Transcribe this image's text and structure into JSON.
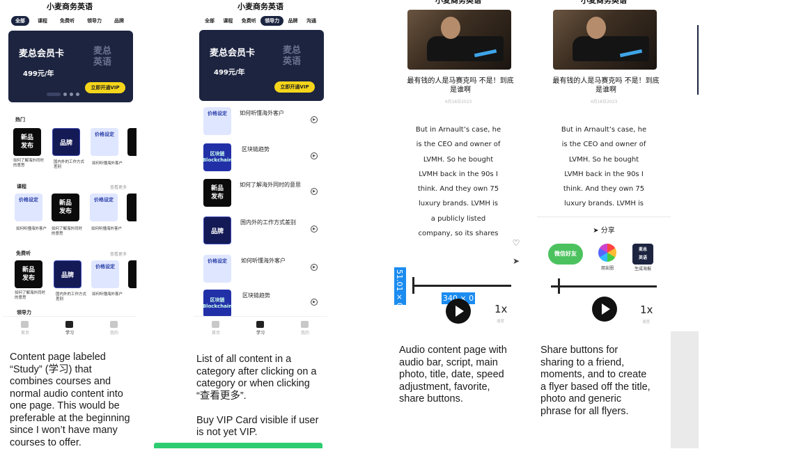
{
  "app": {
    "title": "小麦商务英语"
  },
  "screen1": {
    "tabs": [
      "全部",
      "课程",
      "免费听",
      "领导力",
      "品牌"
    ],
    "vip": {
      "title": "麦总会员卡",
      "price": "499元/年",
      "logo_line1": "麦总",
      "logo_line2": "英语",
      "button": "立即开通VIP"
    },
    "sections": {
      "hot": {
        "title": "热门"
      },
      "course": {
        "title": "课程",
        "more": "查看更多"
      },
      "free": {
        "title": "免费听",
        "more": "查看更多"
      },
      "lead": {
        "title": "领导力"
      }
    },
    "tiles": {
      "new": "新品\n发布",
      "brand": "品牌",
      "price": "价格设定",
      "chain": "区块链\nBlockchain"
    },
    "captions": {
      "c1": "如何了解海外同时的意思",
      "c2": "国内外的工作方式差别",
      "c3": "如何听懂海外客户",
      "c4": "如何了解海外同时的意思"
    },
    "nav": {
      "home": "首页",
      "study": "学习",
      "mine": "我的"
    }
  },
  "screen2": {
    "tabs": [
      "全部",
      "课程",
      "免费听",
      "领导力",
      "品牌",
      "沟通"
    ],
    "vip": {
      "title": "麦总会员卡",
      "price": "499元/年",
      "logo_line1": "麦总",
      "logo_line2": "英语",
      "button": "立即开通VIP"
    },
    "items": [
      {
        "title": "如何听懂海外客户",
        "tile": "价格设定"
      },
      {
        "title": "区块链趋势",
        "tile": "区块链\nBlockchain"
      },
      {
        "title": "如何了解海外同时的意思",
        "tile": "新品\n发布"
      },
      {
        "title": "国内外的工作方式差别",
        "tile": "品牌"
      },
      {
        "title": "如何听懂海外客户",
        "tile": "价格设定"
      },
      {
        "title": "区块链趋势",
        "tile": "区块链\nBlockchain"
      }
    ],
    "nav": {
      "home": "首页",
      "study": "学习",
      "mine": "我的"
    }
  },
  "article": {
    "header": "小麦商务英语",
    "title": "最有钱的人是马赛克吗 不是！到底是谁啊",
    "date": "4月18日2023",
    "body": "But in Arnault’s case, he\nis the CEO and owner of\nLVMH. So he bought\nLVMH back in the 90s I\nthink. And they own 75\nluxury brands. LVMH is\na publicly listed\ncompany, so its shares",
    "body_short": "But in Arnault’s case, he\nis the CEO and owner of\nLVMH. So he bought\nLVMH back in the 90s I\nthink. And they own 75\nluxury brands. LVMH is",
    "speed": "1x",
    "speed_label": "速度",
    "dim_w": "340 × 0",
    "dim_h": "51.01 × 0"
  },
  "share": {
    "head": "分享",
    "friend": "微信好友",
    "moments": "朋友圈",
    "flyer_logo": "麦总\n英语",
    "flyer": "生成海报"
  },
  "captions": {
    "c1": "Content page labeled\n“Study” (学习) that\ncombines courses and\nnormal audio content into\none page. This would be\npreferable at the beginning\nsince I won’t have many\ncourses to offer.",
    "c2": "List of all content in a\ncategory after clicking on a\ncategory or when clicking\n“查看更多”.\n\nBuy VIP Card visible if user\nis not yet VIP.",
    "c3": "Audio content page with\naudio bar, script, main\nphoto, title, date, speed\nadjustment, favorite,\nshare buttons.",
    "c4": "Share buttons for\nsharing to a friend,\nmoments, and to create\na flyer based off the title,\nphoto and generic\nphrase for all flyers."
  },
  "colors": {
    "navy": "#1c2440",
    "vip_yellow": "#f5d51b",
    "wechat_green": "#4cc25f",
    "selection_blue": "#1b8cf0",
    "bottom_bar_green": "#2ecc71"
  }
}
